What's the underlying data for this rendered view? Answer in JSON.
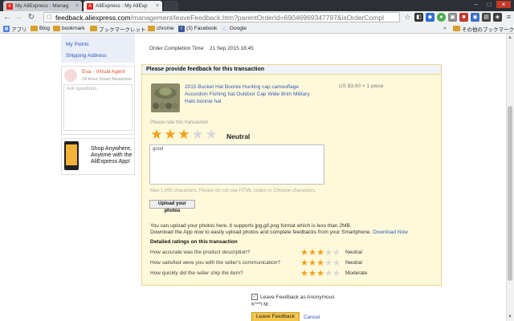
{
  "browser": {
    "tabs": [
      {
        "label": "My AliExpress : Manag"
      },
      {
        "label": "AliExpress : My AliExp"
      }
    ],
    "url_host": "feedback.aliexpress.com",
    "url_path": "/management/leaveFeedback.htm?parentOrderId=69046969347797&isOrderCompl",
    "bookmarks": [
      "アプリ",
      "Blog",
      "bookmark",
      "ブックマークレット",
      "chrome",
      "(3) Facebook",
      "Google"
    ],
    "other_bookmarks": "その他のブックマーク"
  },
  "sidebar": {
    "links": [
      "My Points",
      "Shipping Address"
    ],
    "agent_name": "Eva - Virtual Agent",
    "agent_sub": "24 Hour Smart Response",
    "ask_placeholder": "Ask questions",
    "app_promo": "Shop Anywhere, Anytime with the AliExpress App!"
  },
  "order": {
    "completion_label": "Order Completion Time:",
    "completion_value": "21 Sep 2015 18:45"
  },
  "feedback": {
    "header": "Please provide feedback for this transaction",
    "product_title": "2015 Bucket Hat Boonie Hunting cap camouflage Accordion Fishing hat Outdoor Cap Wide Brim Military Hats bonnie hat",
    "price": "US $3.60 × 1 piece",
    "rate_label": "Please rate this transaction",
    "rating": 3,
    "rating_max": 5,
    "rating_text": "Neutral",
    "comment": "good",
    "max_chars": "Max 1,000 characters. Please do not use HTML codes or Chinese characters.",
    "upload_button": "Upload your photos",
    "upload_info_1": "You can upload your photos here, it supports jpg,gif,png format which is less than 2MB.",
    "upload_info_2": "Download the App now to easily upload photos and complete feedbacks from your Smartphone.",
    "download_link": "Download Now",
    "detailed_header": "Detailed ratings on this transaction",
    "detailed": [
      {
        "question": "How accurate was the product description?",
        "rating": 3,
        "verdict": "Neutral"
      },
      {
        "question": "How satisfied were you with the seller's communication?",
        "rating": 3,
        "verdict": "Neutral"
      },
      {
        "question": "How quickly did the seller ship the item?",
        "rating": 3,
        "verdict": "Moderate"
      }
    ],
    "anonymous_label": "Leave Feedback as Anonymous",
    "username": "K***i M.",
    "leave_button": "Leave Feedback",
    "cancel_link": "Cancel"
  },
  "colors": {
    "star_on": "#f2a11a",
    "star_off": "#d8d8d8",
    "card_bg": "#fff9db",
    "link": "#2d5ab8"
  }
}
